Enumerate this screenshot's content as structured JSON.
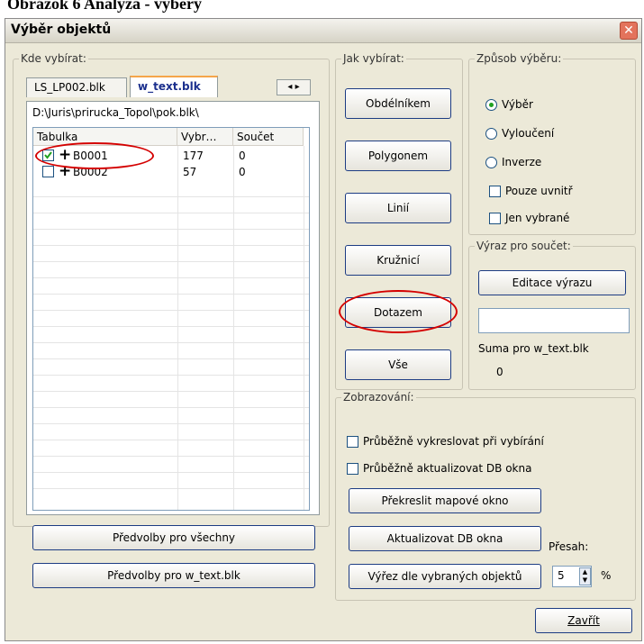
{
  "caption": "Obrázok 6 Analýza - výbery",
  "window": {
    "title": "Výběr objektů",
    "close_icon": "close-icon"
  },
  "kde": {
    "legend": "Kde vybírat:",
    "tabs": [
      {
        "label": "LS_LP002.blk",
        "active": false
      },
      {
        "label": "w_text.blk",
        "active": true
      }
    ],
    "path": "D:\\Juris\\prirucka_Topol\\pok.blk\\",
    "columns": [
      "Tabulka",
      "Vybr…",
      "Součet"
    ],
    "rows": [
      {
        "checked": true,
        "name": "B0001",
        "vybr": "177",
        "soucet": "0"
      },
      {
        "checked": false,
        "name": "B0002",
        "vybr": "57",
        "soucet": "0"
      }
    ]
  },
  "jak": {
    "legend": "Jak vybírat:",
    "buttons": [
      "Obdélníkem",
      "Polygonem",
      "Linií",
      "Kružnicí",
      "Dotazem",
      "Vše"
    ]
  },
  "zpusob": {
    "legend": "Způsob výběru:",
    "radios": [
      {
        "label": "Výběr",
        "selected": true
      },
      {
        "label": "Vyloučení",
        "selected": false
      },
      {
        "label": "Inverze",
        "selected": false
      }
    ],
    "checks": [
      {
        "label": "Pouze uvnitř",
        "checked": false
      },
      {
        "label": "Jen vybrané",
        "checked": false
      }
    ]
  },
  "vyraz": {
    "legend": "Výraz pro součet:",
    "edit_button": "Editace výrazu",
    "input_value": "",
    "suma_label": "Suma pro w_text.blk",
    "suma_value": "0"
  },
  "zobrazovani": {
    "legend": "Zobrazování:",
    "checks": [
      {
        "label": "Průběžně vykreslovat při vybírání",
        "checked": false
      },
      {
        "label": "Průběžně aktualizovat DB okna",
        "checked": false
      }
    ],
    "buttons": [
      "Překreslit mapové okno",
      "Aktualizovat DB okna",
      "Výřez dle vybraných objektů"
    ],
    "presah_label": "Přesah:",
    "presah_value": "5",
    "percent": "%"
  },
  "bottom": {
    "predvolby_all": "Předvolby pro všechny",
    "predvolby_file": "Předvolby pro w_text.blk",
    "close": "Zavřít"
  }
}
